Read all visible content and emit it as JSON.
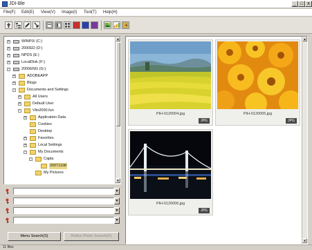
{
  "window": {
    "title": "JDI-Ble",
    "minimize_glyph": "_",
    "maximize_glyph": "□",
    "close_glyph": "x"
  },
  "menu": [
    "File(F)",
    "Edit(E)",
    "View(V)",
    "Image(I)",
    "Tool(T)",
    "Help(H)"
  ],
  "toolbar": {
    "icons": [
      "up-folder-icon",
      "folder-tree-icon",
      "pen-icon",
      "arrow-icon",
      "view-list-icon",
      "view-details-icon",
      "view-thumb-icon",
      "color-red-icon",
      "color-blue-icon",
      "color-purple-icon",
      "image-icon",
      "chart-icon",
      "export-icon"
    ]
  },
  "tree": {
    "items": [
      {
        "label": "WINPIX (C:)",
        "type": "drive",
        "level": 0,
        "expander": "+"
      },
      {
        "label": "2000ED (D:)",
        "type": "drive",
        "level": 0,
        "expander": "+"
      },
      {
        "label": "NPDS (E:)",
        "type": "drive",
        "level": 0,
        "expander": "+"
      },
      {
        "label": "LocalDisk (F:)",
        "type": "drive",
        "level": 0,
        "expander": "+"
      },
      {
        "label": "2000ENG (G:)",
        "type": "drive",
        "level": 0,
        "expander": "-"
      },
      {
        "label": "ADOBEAPP",
        "type": "folder",
        "level": 1,
        "expander": "+"
      },
      {
        "label": "Blogs",
        "type": "folder",
        "level": 1,
        "expander": "+"
      },
      {
        "label": "Documents and Settings",
        "type": "folder",
        "level": 1,
        "expander": "-"
      },
      {
        "label": "All Users",
        "type": "folder",
        "level": 2,
        "expander": "+"
      },
      {
        "label": "Default User",
        "type": "folder",
        "level": 2,
        "expander": "+"
      },
      {
        "label": "Vito2000.fun",
        "type": "folder",
        "level": 2,
        "expander": "-"
      },
      {
        "label": "Application Data",
        "type": "folder",
        "level": 3,
        "expander": "+"
      },
      {
        "label": "Cookies",
        "type": "folder",
        "level": 3,
        "expander": ""
      },
      {
        "label": "Desktop",
        "type": "folder",
        "level": 3,
        "expander": ""
      },
      {
        "label": "Favorites",
        "type": "folder",
        "level": 3,
        "expander": "+"
      },
      {
        "label": "Local Settings",
        "type": "folder",
        "level": 3,
        "expander": "+"
      },
      {
        "label": "My Documents",
        "type": "folder",
        "level": 3,
        "expander": "-"
      },
      {
        "label": "Capla",
        "type": "folder",
        "level": 4,
        "expander": "-"
      },
      {
        "label": "20071108",
        "type": "folder",
        "level": 5,
        "expander": "",
        "selected": true
      },
      {
        "label": "My Pictures",
        "type": "folder",
        "level": 4,
        "expander": ""
      }
    ]
  },
  "search": {
    "fields": [
      {
        "value": ""
      },
      {
        "value": ""
      },
      {
        "value": ""
      },
      {
        "value": ""
      }
    ],
    "search_button": "Menu Search(S)",
    "options_button": "Refine Photo Search(O)"
  },
  "thumbnails": [
    {
      "filename": "PIH-0120004.jpg",
      "badge": "JPG",
      "image": "rapeseed-field"
    },
    {
      "filename": "PIH-0120005.jpg",
      "badge": "JPG",
      "image": "yellow-flowers"
    },
    {
      "filename": "PIH-0120006.jpg",
      "badge": "JPG",
      "image": "night-bridge"
    }
  ],
  "status": {
    "text": "11 files"
  },
  "colors": {
    "chrome": "#d4d0c8",
    "selection": "#e9d98a",
    "folder": "#f2d26a",
    "badge": "#4a4a4a"
  }
}
